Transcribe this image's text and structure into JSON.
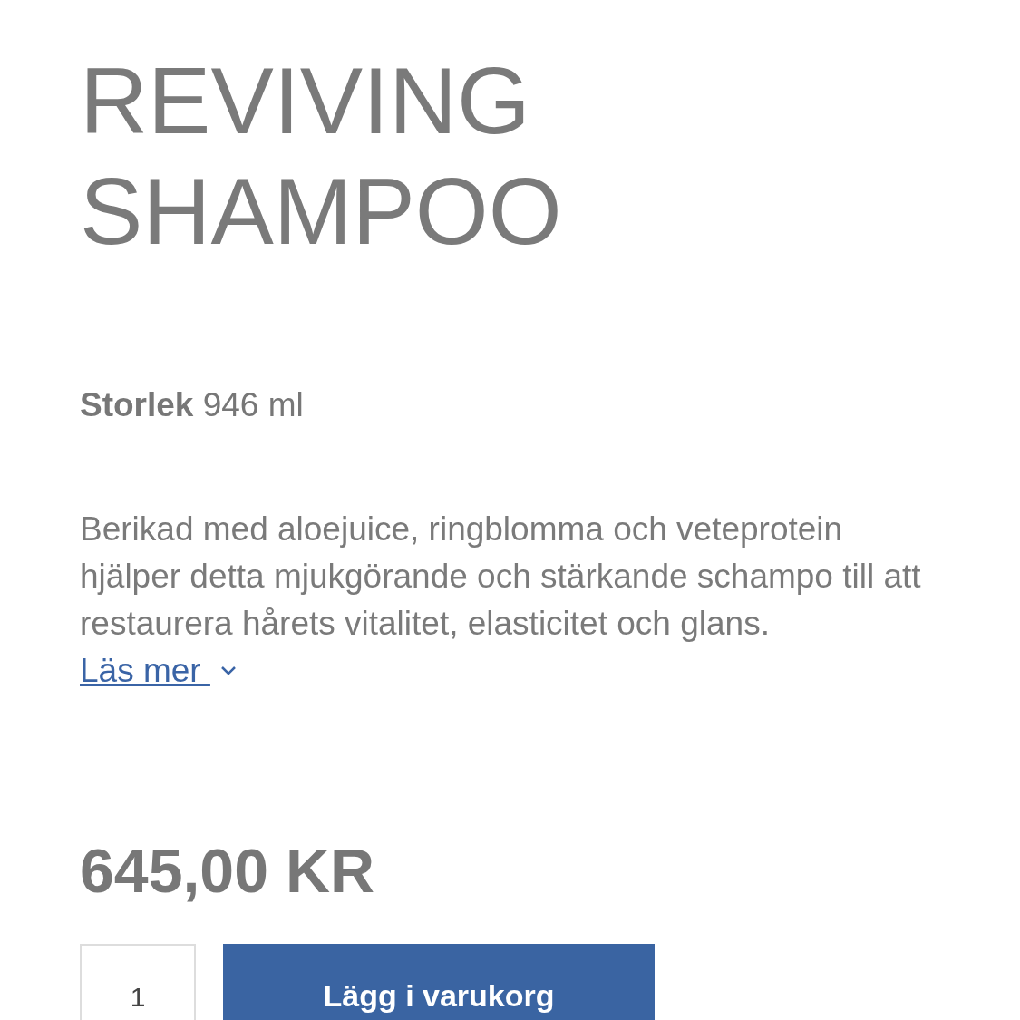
{
  "product": {
    "title_lines": [
      "REVIVING",
      "SHAMPOO"
    ],
    "size": {
      "label": "Storlek",
      "value": "946 ml"
    },
    "description": "Berikad med aloejuice, ringblomma och veteprotein hjälper detta mjukgörande och stärkande schampo till att restaurera hårets vitalitet, elasticitet och glans.",
    "read_more": {
      "label": "Läs mer ",
      "expanded": false
    },
    "price": "645,00 KR",
    "quantity": "1",
    "add_to_cart": "Lägg i varukorg"
  }
}
